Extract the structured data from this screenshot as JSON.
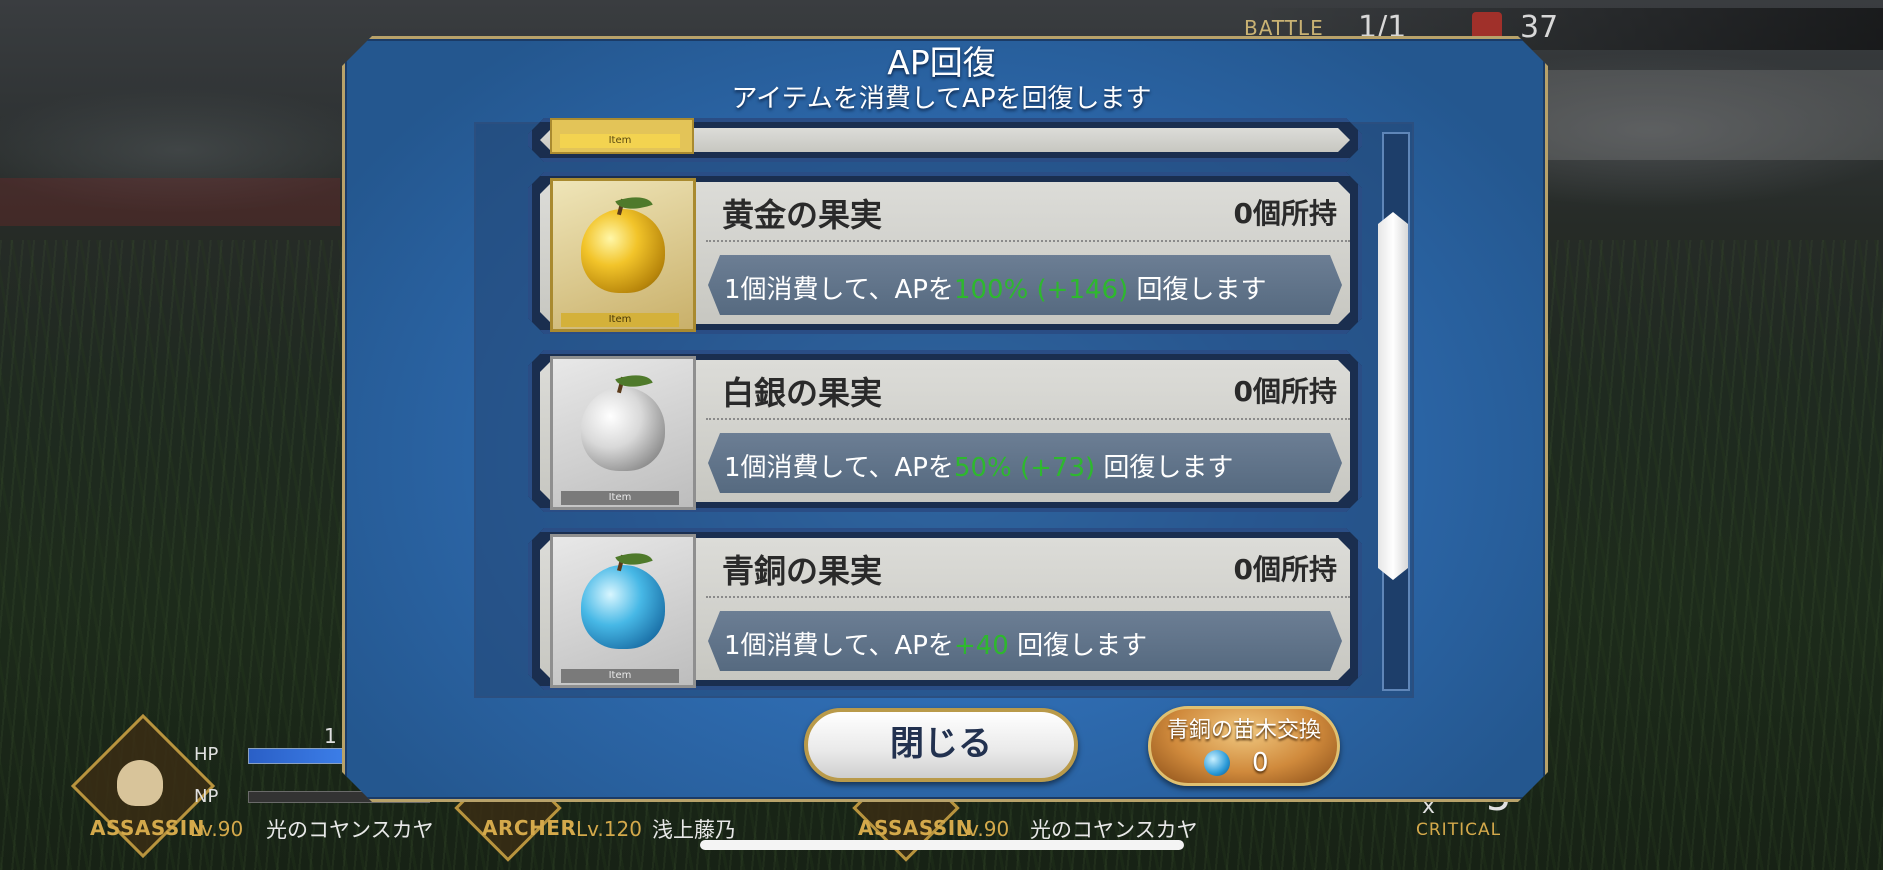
{
  "hud": {
    "battle_label": "BATTLE",
    "battle_value": "1/1",
    "enemy_count": "37"
  },
  "dialog": {
    "title": "AP回復",
    "subtitle": "アイテムを消費してAPを回復します"
  },
  "items": [
    {
      "name": "黄金の果実",
      "owned": "0個所持",
      "icon": "golden-apple-icon",
      "tag": "Item",
      "effect_prefix": "1個消費して、APを",
      "effect_highlight": "100% (+146)",
      "effect_suffix": " 回復します"
    },
    {
      "name": "白銀の果実",
      "owned": "0個所持",
      "icon": "silver-apple-icon",
      "tag": "Item",
      "effect_prefix": "1個消費して、APを",
      "effect_highlight": "50% (+73)",
      "effect_suffix": " 回復します"
    },
    {
      "name": "青銅の果実",
      "owned": "0個所持",
      "icon": "bronze-apple-icon",
      "tag": "Item",
      "effect_prefix": "1個消費して、APを",
      "effect_highlight": "+40",
      "effect_suffix": " 回復します"
    }
  ],
  "partial_item_tag": "Item",
  "buttons": {
    "close_label": "閉じる",
    "exchange_label": "青銅の苗木交換",
    "exchange_count": "0"
  },
  "party": [
    {
      "class": "ASSASSIN",
      "level": "Lv.90",
      "name": "光のコヤンスカヤ"
    },
    {
      "class": "ARCHER",
      "level": "Lv.120",
      "name": "浅上藤乃"
    },
    {
      "class": "ASSASSIN",
      "level": "Lv.90",
      "name": "光のコヤンスカヤ"
    }
  ],
  "party_bars": {
    "hp_label": "HP",
    "np_label": "NP"
  },
  "critical": {
    "multiplier": "x",
    "value": "5",
    "label": "CRITICAL"
  },
  "colors": {
    "dialog_blue": "#2f6db3",
    "gold_border": "#b8a26a",
    "effect_green": "#2eb82e"
  }
}
